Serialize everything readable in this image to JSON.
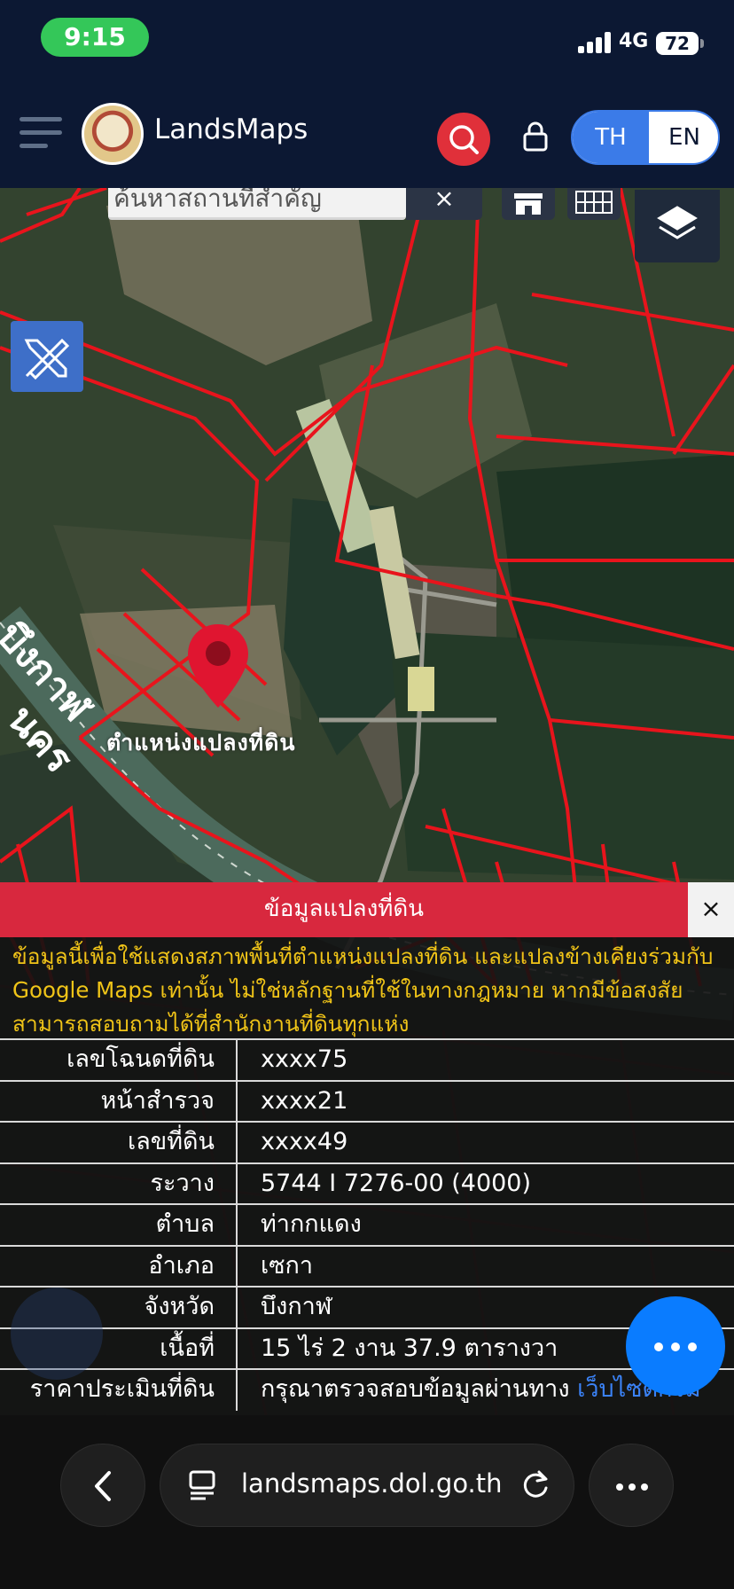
{
  "status_bar": {
    "time": "9:15",
    "network": "4G",
    "battery": "72"
  },
  "header": {
    "app_title": "LandsMaps",
    "lang_th": "TH",
    "lang_en": "EN"
  },
  "map": {
    "search_placeholder": "ค้นหาสถานที่สำคัญ",
    "clear_symbol": "×",
    "pin_label": "ตำแหน่งแปลงที่ดิน",
    "road_label_1": "บึงกาฬ",
    "road_label_2": "นคร"
  },
  "panel": {
    "title": "ข้อมูลแปลงที่ดิน",
    "close_symbol": "×",
    "disclaimer": "ข้อมูลนี้เพื่อใช้แสดงสภาพพื้นที่ตำแหน่งแปลงที่ดิน และแปลงข้างเคียงร่วมกับ Google Maps เท่านั้น ไม่ใช่หลักฐานที่ใช้ในทางกฎหมาย หากมีข้อสงสัยสามารถสอบถามได้ที่สำนักงานที่ดินทุกแห่ง",
    "rows": [
      {
        "label": "เลขโฉนดที่ดิน",
        "value": "xxxx75"
      },
      {
        "label": "หน้าสำรวจ",
        "value": "xxxx21"
      },
      {
        "label": "เลขที่ดิน",
        "value": "xxxx49"
      },
      {
        "label": "ระวาง",
        "value": "5744 I 7276-00 (4000)"
      },
      {
        "label": "ตำบล",
        "value": "ท่ากกแดง"
      },
      {
        "label": "อำเภอ",
        "value": "เซกา"
      },
      {
        "label": "จังหวัด",
        "value": "บึงกาฬ"
      },
      {
        "label": "เนื้อที่",
        "value": "15 ไร่ 2 งาน 37.9 ตารางวา"
      },
      {
        "label": "ราคาประเมินที่ดิน",
        "value": "กรุณาตรวจสอบข้อมูลผ่านทาง ",
        "link": "เว็บไซต์กรม"
      }
    ]
  },
  "browser": {
    "url": "landsmaps.dol.go.th"
  },
  "colors": {
    "accent_red": "#d8283e",
    "accent_blue": "#3b7be8",
    "parcel_line": "#e8141c",
    "disclaimer": "#f0c418",
    "fab": "#0a7cff"
  }
}
